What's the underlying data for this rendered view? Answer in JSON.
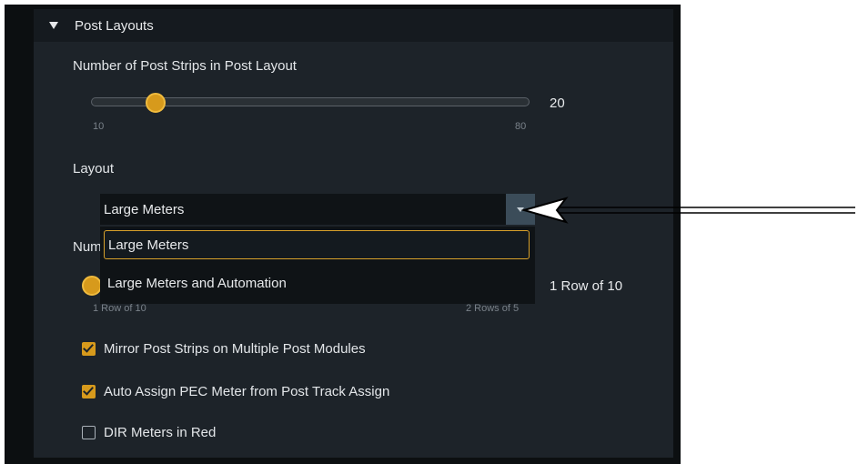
{
  "section": {
    "title": "Post Layouts"
  },
  "strips": {
    "label": "Number of Post Strips in Post Layout",
    "min_label": "10",
    "max_label": "80",
    "value": "20",
    "fraction": 0.14
  },
  "layout": {
    "label": "Layout",
    "selected": "Large Meters",
    "options": [
      "Large Meters",
      "Large Meters and Automation"
    ]
  },
  "rows": {
    "label_partial": "Num",
    "min_label": "1 Row of 10",
    "max_label": "2 Rows of 5",
    "value": "1 Row of 10",
    "fraction": 0.0
  },
  "options": [
    {
      "label": "Mirror Post Strips on Multiple Post Modules",
      "checked": true
    },
    {
      "label": "Auto Assign PEC Meter from Post Track Assign",
      "checked": true
    },
    {
      "label": "DIR Meters in Red",
      "checked": false
    }
  ],
  "colors": {
    "accent": "#d79a1c",
    "panel": "#1d2329",
    "header": "#151a1f",
    "background": "#0c0f11"
  }
}
